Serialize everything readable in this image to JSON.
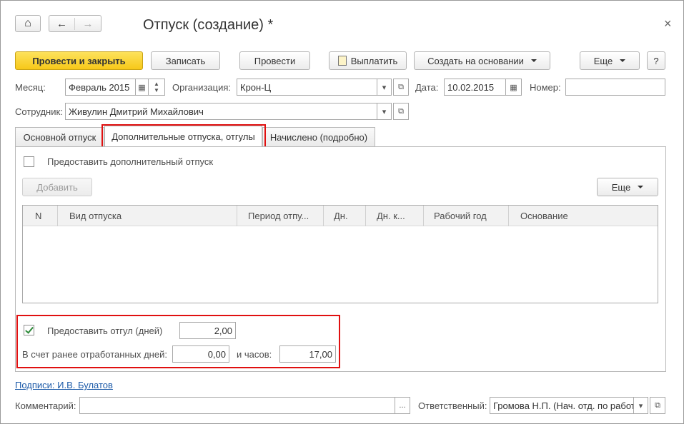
{
  "window": {
    "title": "Отпуск (создание) *",
    "close_glyph": "×"
  },
  "nav": {
    "home_glyph": "⌂",
    "back_glyph": "←",
    "forward_glyph": "→"
  },
  "toolbar": {
    "post_close": "Провести и закрыть",
    "save": "Записать",
    "post": "Провести",
    "pay": "Выплатить",
    "create_based": "Создать на основании",
    "more": "Еще",
    "help": "?"
  },
  "fields": {
    "month_label": "Месяц:",
    "month_value": "Февраль 2015",
    "org_label": "Организация:",
    "org_value": "Крон-Ц",
    "date_label": "Дата:",
    "date_value": "10.02.2015",
    "number_label": "Номер:",
    "number_value": "",
    "employee_label": "Сотрудник:",
    "employee_value": "Живулин Дмитрий Михайлович"
  },
  "tabs": [
    {
      "label": "Основной отпуск",
      "active": false
    },
    {
      "label": "Дополнительные отпуска, отгулы",
      "active": true
    },
    {
      "label": "Начислено (подробно)",
      "active": false
    }
  ],
  "extra_leave": {
    "checkbox_label": "Предоставить дополнительный отпуск",
    "checked": false,
    "add_button": "Добавить",
    "more_button": "Еще",
    "columns": [
      "N",
      "Вид отпуска",
      "Период отпу...",
      "Дн.",
      "Дн. к...",
      "Рабочий год",
      "Основание"
    ],
    "rows": []
  },
  "time_off": {
    "checkbox_label": "Предоставить отгул (дней)",
    "checked": true,
    "days_value": "2,00",
    "worked_days_label": "В счет ранее отработанных дней:",
    "worked_days_value": "0,00",
    "hours_label": "и часов:",
    "hours_value": "17,00"
  },
  "footer": {
    "signatures_link": "Подписи: И.В. Булатов",
    "comment_label": "Комментарий:",
    "comment_value": "",
    "comment_button": "...",
    "responsible_label": "Ответственный:",
    "responsible_value": "Громова Н.П. (Нач. отд. по работ"
  },
  "colors": {
    "primary_button": "#f7c819",
    "highlight_frame": "#e01010",
    "link": "#1c5aa8"
  }
}
